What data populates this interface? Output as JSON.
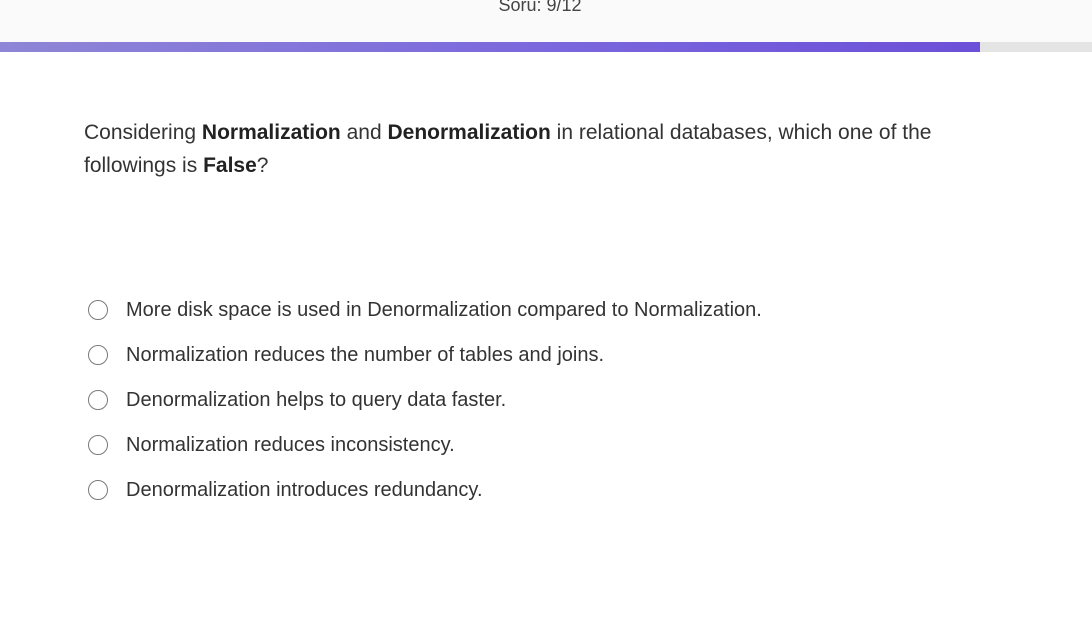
{
  "header": {
    "counter": "Soru: 9/12",
    "progress": 0.897
  },
  "question": {
    "t1": "Considering ",
    "b1": "Normalization",
    "t2": " and ",
    "b2": "Denormalization",
    "t3": " in relational databases, which one of the followings is ",
    "b3": "False",
    "t4": "?"
  },
  "options": [
    {
      "label": "More disk space is used in Denormalization compared to Normalization."
    },
    {
      "label": "Normalization reduces the number of tables and joins."
    },
    {
      "label": "Denormalization helps to query data faster."
    },
    {
      "label": "Normalization reduces inconsistency."
    },
    {
      "label": "Denormalization introduces redundancy."
    }
  ]
}
